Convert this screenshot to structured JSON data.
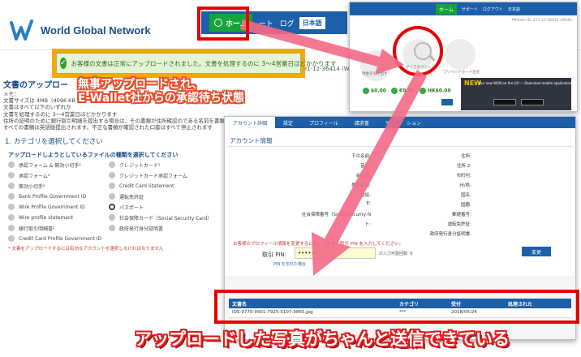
{
  "main": {
    "logo_text": "World Global Network",
    "nav": {
      "home": "ホーム",
      "item2": "ート",
      "item3": "ログ",
      "lang": "日本語"
    },
    "notice": "お客様の文書は正常にアップロードされました。文書を処理するのに 3〜4営業日ほどかかります",
    "phone_fragment": "(日本)英語:+81-12-36414 (WGN)",
    "upload_title": "文書のアップロー",
    "memo_label": "メモ：",
    "memo_lines": [
      "文書サイズは 4MB（4096 KB",
      "文書はすべて以下のいずれか",
      "文書を処理するのに 3〜4営業日ほどかかります",
      "住所の証明のために銀行取引明細を提出する場合は、その書類が住所確認のである名前を書類上",
      "すべての書類は英語版提出されます。不正な書類が確認された口座はすべて停止されます"
    ],
    "categories_title": "1. カテゴリを選択してください",
    "categories_sub": "アップロードしようとしているファイルの種類を選択してください",
    "categories": [
      {
        "label": "承認フォーム & 無効小切手²",
        "selected": false
      },
      {
        "label": "クレジットカード¹",
        "selected": false
      },
      {
        "label": "承認フォーム²",
        "selected": false
      },
      {
        "label": "クレジットカード承認フォーム",
        "selected": false
      },
      {
        "label": "無効小切手²",
        "selected": false
      },
      {
        "label": "Credit Card Statement",
        "selected": false
      },
      {
        "label": "Bank Profile Government ID",
        "selected": false
      },
      {
        "label": "運転免許証",
        "selected": false
      },
      {
        "label": "Wire Profile Government ID",
        "selected": false
      },
      {
        "label": "パスポート",
        "selected": true
      },
      {
        "label": "Wire profile statement",
        "selected": false
      },
      {
        "label": "社会保障カード（Social Security Card）",
        "selected": false
      },
      {
        "label": "銀行取引明細書²",
        "selected": false
      },
      {
        "label": "政府発行身分証明書",
        "selected": false
      },
      {
        "label": "Credit Card Profile Government ID",
        "selected": false
      },
      {
        "label": "",
        "selected": false
      }
    ],
    "categories_note": "* 文書をアップロードするには有効なアカウントを選択しなければなりません"
  },
  "annotation_top": {
    "line1": "無事アップロードされ、",
    "line2": "E-Wallet社からの承認待ち状態"
  },
  "right_panel": {
    "nav_home": "ホーム",
    "nav_items": [
      "サポート",
      "ログアウト",
      "日本語"
    ],
    "sub_text": "Affiliate ID: 271-12-36414 (WGN)",
    "tiles": [
      "現金を引き出す",
      "マイアカウント",
      "プリペイドカード注文"
    ],
    "balances": [
      "$0.00",
      "€0.00",
      "HK$0.00"
    ],
    "promo_badge": "NEW",
    "promo_text": "Our new WGN on the GO — Download mobile application"
  },
  "account": {
    "tabs": [
      "アカウント詳細",
      "設定",
      "プロフィール",
      "請求書",
      "サ",
      "ション"
    ],
    "info_title": "アカウント情報",
    "fields_left": [
      "下の名前:",
      "苗字:",
      "会社名:",
      "携帯電話:",
      "電話:",
      "E:",
      "社会保障番号（Social Security N",
      "ト:"
    ],
    "fields_right": [
      "住所:",
      "住所 2:",
      "市町村:",
      "州/県:",
      "国名:",
      "国籍:",
      "郵便番号:",
      "運転免許証:",
      "政府発行身分証明書:"
    ],
    "warning": "お客様のプロフィール情報を変更するには、ご自身の取引 PIN を入力してください。",
    "pin_label": "取引 PIN:",
    "pin_value": "••••••",
    "pin_hint": "の入力可能回数: 6",
    "pin_link": "PIN を忘れた場合",
    "change_button": "変更",
    "doc_headers": [
      "文書名",
      "カテゴリ",
      "受付",
      "処理された"
    ],
    "doc_row": [
      "IOS-9770-9901-7925-5107-9865.jpg",
      "***",
      "2018/05/24",
      ""
    ]
  },
  "annotation_bottom": "アップロードした写真がちゃんと送信できている",
  "colors": {
    "brand_blue": "#1d5fa8",
    "highlight_red": "#e60000",
    "notice_orange": "#f6a900",
    "arrow_pink": "#f46a86"
  }
}
